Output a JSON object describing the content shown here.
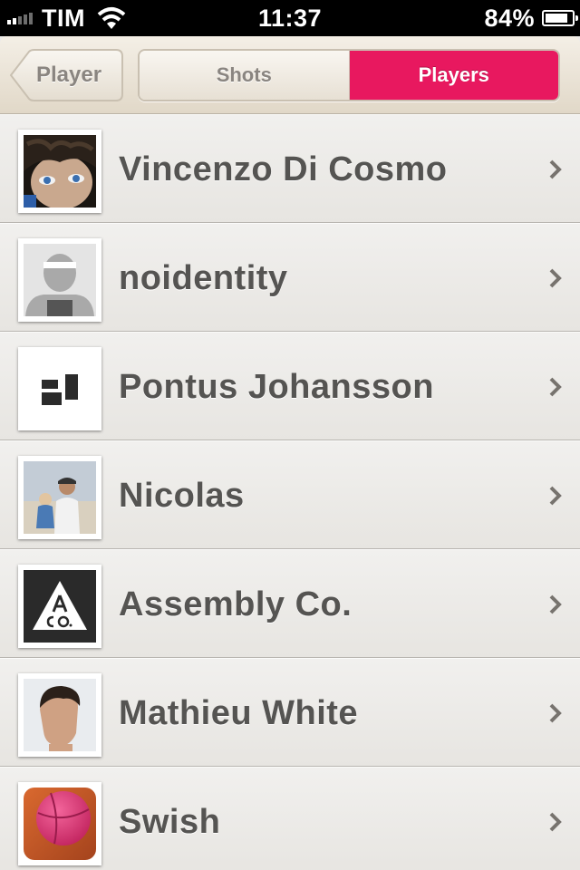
{
  "status_bar": {
    "carrier": "TIM",
    "time": "11:37",
    "battery": "84%",
    "battery_level": 0.84
  },
  "nav": {
    "back_label": "Player",
    "segments": [
      "Shots",
      "Players"
    ],
    "selected_segment": "Players",
    "accent_color": "#e8185f"
  },
  "players": [
    {
      "name": "Vincenzo Di Cosmo",
      "avatar": "portrait-photo-icon"
    },
    {
      "name": "noidentity",
      "avatar": "default-avatar-icon"
    },
    {
      "name": "Pontus Johansson",
      "avatar": "blocks-logo-icon"
    },
    {
      "name": "Nicolas",
      "avatar": "beach-photo-icon"
    },
    {
      "name": "Assembly Co.",
      "avatar": "assembly-logo-icon"
    },
    {
      "name": "Mathieu White",
      "avatar": "profile-photo-icon"
    },
    {
      "name": "Swish",
      "avatar": "basketball-icon"
    }
  ]
}
